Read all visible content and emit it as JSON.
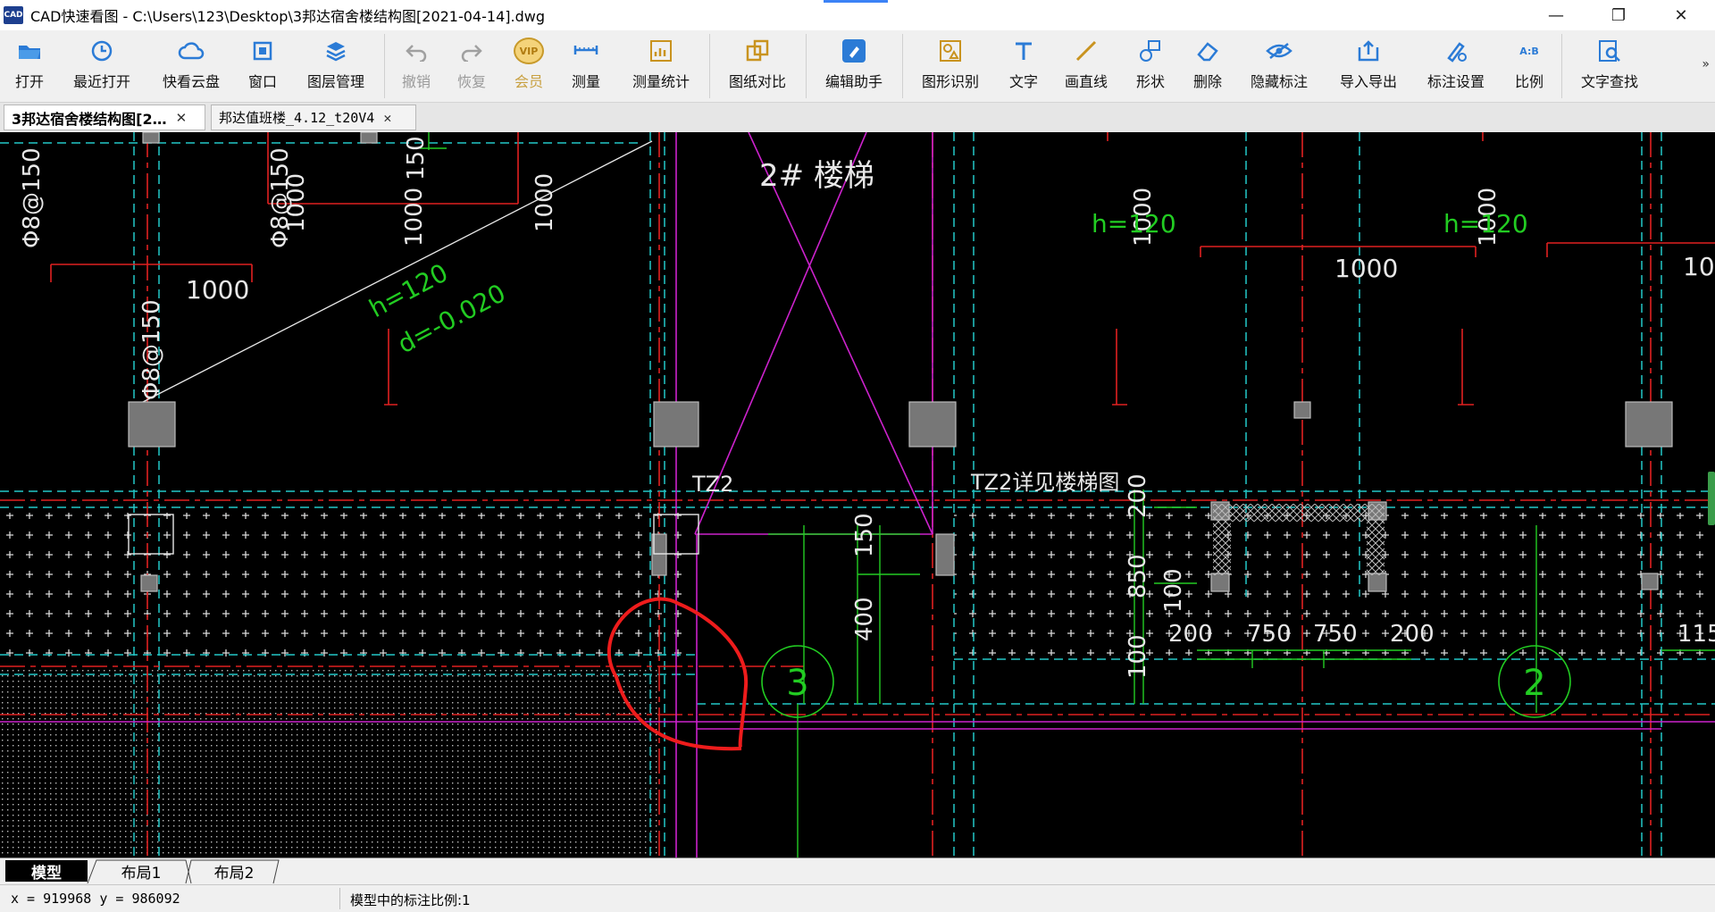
{
  "window": {
    "logo_text": "CAD",
    "title": "CAD快速看图 - C:\\Users\\123\\Desktop\\3邦达宿舍楼结构图[2021-04-14].dwg",
    "accent_color": "#3b82f6"
  },
  "toolbar": {
    "items": [
      {
        "label": "打开",
        "icon": "open-folder-icon",
        "enabled": true
      },
      {
        "label": "最近打开",
        "icon": "recent-clock-icon",
        "enabled": true
      },
      {
        "label": "快看云盘",
        "icon": "cloud-icon",
        "enabled": true
      },
      {
        "label": "窗口",
        "icon": "window-icon",
        "enabled": true
      },
      {
        "label": "图层管理",
        "icon": "layers-icon",
        "enabled": true
      },
      {
        "label": "撤销",
        "icon": "undo-icon",
        "enabled": false
      },
      {
        "label": "恢复",
        "icon": "redo-icon",
        "enabled": false
      },
      {
        "label": "会员",
        "icon": "vip-icon",
        "enabled": false
      },
      {
        "label": "测量",
        "icon": "ruler-icon",
        "enabled": true
      },
      {
        "label": "测量统计",
        "icon": "measure-stats-icon",
        "enabled": true
      },
      {
        "label": "图纸对比",
        "icon": "compare-icon",
        "enabled": true
      },
      {
        "label": "编辑助手",
        "icon": "edit-assistant-icon",
        "enabled": true
      },
      {
        "label": "图形识别",
        "icon": "shape-recognize-icon",
        "enabled": true
      },
      {
        "label": "文字",
        "icon": "text-icon",
        "enabled": true
      },
      {
        "label": "画直线",
        "icon": "line-icon",
        "enabled": true
      },
      {
        "label": "形状",
        "icon": "shape-icon",
        "enabled": true
      },
      {
        "label": "删除",
        "icon": "eraser-icon",
        "enabled": true
      },
      {
        "label": "隐藏标注",
        "icon": "eye-hide-icon",
        "enabled": true
      },
      {
        "label": "导入导出",
        "icon": "import-export-icon",
        "enabled": true
      },
      {
        "label": "标注设置",
        "icon": "annotation-settings-icon",
        "enabled": true
      },
      {
        "label": "比例",
        "icon": "ratio-icon",
        "enabled": true
      },
      {
        "label": "文字查找",
        "icon": "text-search-icon",
        "enabled": true
      }
    ],
    "ratio_icon_text": "A:B",
    "vip_icon_text": "VIP",
    "overflow": "»"
  },
  "doc_tabs": [
    {
      "label": "3邦达宿舍楼结构图[2…",
      "active": true
    },
    {
      "label": "邦达值班楼_4.12_t20V4",
      "active": false
    }
  ],
  "drawing": {
    "labels": {
      "stair": "2# 楼梯",
      "h120": "h=120",
      "d_value": "d=-0.020",
      "rebar": "Φ8@150",
      "tz2": "TZ2",
      "tz2_note": "TZ2详见楼梯图",
      "axis_3": "3",
      "axis_2": "2"
    },
    "dims": {
      "d1000": "1000",
      "d150": "150",
      "d400": "400",
      "d200": "200",
      "d850": "850",
      "d100": "100",
      "d750": "750",
      "d1150": "115("
    }
  },
  "layout_tabs": [
    {
      "label": "模型",
      "active": true
    },
    {
      "label": "布局1",
      "active": false
    },
    {
      "label": "布局2",
      "active": false
    }
  ],
  "status": {
    "coords": "x = 919968  y = 986092",
    "scale": "模型中的标注比例:1"
  }
}
